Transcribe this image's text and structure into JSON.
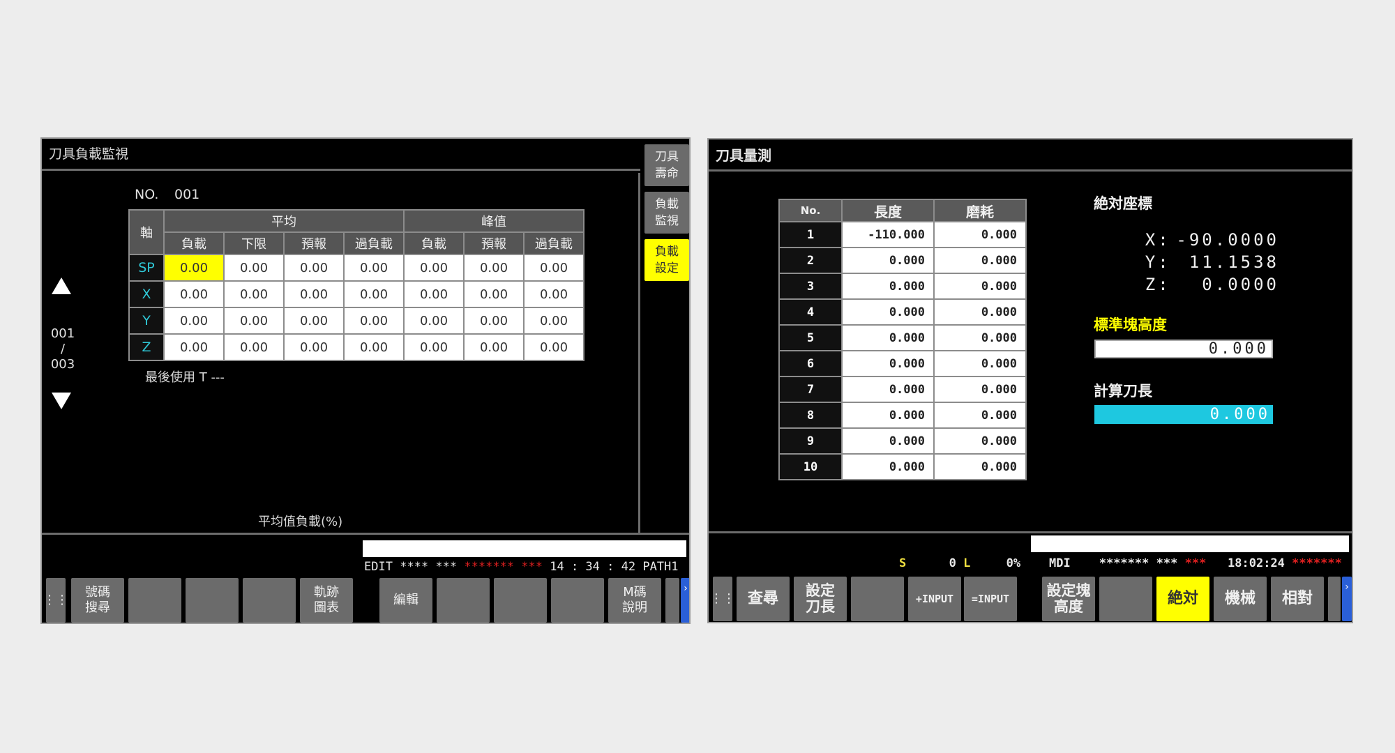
{
  "left": {
    "title": "刀具負載監視",
    "no_label": "NO.",
    "no_value": "001",
    "table": {
      "axis_header": "軸",
      "group_avg": "平均",
      "group_peak": "峰值",
      "sub_headers": [
        "負載",
        "下限",
        "預報",
        "過負載",
        "負載",
        "預報",
        "過負載"
      ],
      "rows": [
        {
          "axis": "SP",
          "values": [
            "0.00",
            "0.00",
            "0.00",
            "0.00",
            "0.00",
            "0.00",
            "0.00"
          ]
        },
        {
          "axis": "X",
          "values": [
            "0.00",
            "0.00",
            "0.00",
            "0.00",
            "0.00",
            "0.00",
            "0.00"
          ]
        },
        {
          "axis": "Y",
          "values": [
            "0.00",
            "0.00",
            "0.00",
            "0.00",
            "0.00",
            "0.00",
            "0.00"
          ]
        },
        {
          "axis": "Z",
          "values": [
            "0.00",
            "0.00",
            "0.00",
            "0.00",
            "0.00",
            "0.00",
            "0.00"
          ]
        }
      ]
    },
    "last_used": "最後使用 T  ---",
    "page_current": "001",
    "page_sep": "/",
    "page_total": "003",
    "avg_caption": "平均值負載(%)",
    "side_buttons": [
      {
        "line1": "刀具",
        "line2": "壽命"
      },
      {
        "line1": "負載",
        "line2": "監視"
      },
      {
        "line1": "負載",
        "line2": "設定"
      }
    ],
    "status": {
      "mode": "EDIT",
      "s1": "****",
      "s2": "***",
      "s3": "*******",
      "s4": "***",
      "time": "14 : 34 : 42",
      "path": "PATH1"
    },
    "softkeys": {
      "k1a": "號碼",
      "k1b": "搜尋",
      "k2a": "軌跡",
      "k2b": "圖表",
      "k3": "編輯",
      "k4a": "M碼",
      "k4b": "說明",
      "more": "›"
    }
  },
  "right": {
    "title": "刀具量測",
    "table": {
      "headers": [
        "No.",
        "長度",
        "磨耗"
      ],
      "rows": [
        {
          "no": "1",
          "length": "-110.000",
          "wear": "0.000"
        },
        {
          "no": "2",
          "length": "0.000",
          "wear": "0.000"
        },
        {
          "no": "3",
          "length": "0.000",
          "wear": "0.000"
        },
        {
          "no": "4",
          "length": "0.000",
          "wear": "0.000"
        },
        {
          "no": "5",
          "length": "0.000",
          "wear": "0.000"
        },
        {
          "no": "6",
          "length": "0.000",
          "wear": "0.000"
        },
        {
          "no": "7",
          "length": "0.000",
          "wear": "0.000"
        },
        {
          "no": "8",
          "length": "0.000",
          "wear": "0.000"
        },
        {
          "no": "9",
          "length": "0.000",
          "wear": "0.000"
        },
        {
          "no": "10",
          "length": "0.000",
          "wear": "0.000"
        }
      ]
    },
    "abs_title": "絶対座標",
    "coord": {
      "x_label": "X:",
      "x_value": "-90.0000",
      "y_label": "Y:",
      "y_value": "11.1538",
      "z_label": "Z:",
      "z_value": "0.0000"
    },
    "std_block_title": "標準塊高度",
    "std_block_value": "0.000",
    "calc_length_title": "計算刀長",
    "calc_length_value": "0.000",
    "status": {
      "s_label": "S",
      "s_value": "0",
      "l_label": "L",
      "l_value": "0%",
      "mode": "MDI",
      "s1": "*******",
      "s2": "***",
      "s3": "***",
      "time": "18:02:24",
      "s4": "*******"
    },
    "softkeys": {
      "search": "查尋",
      "set_len_a": "設定",
      "set_len_b": "刀長",
      "plus_input": "+INPUT",
      "eq_input": "=INPUT",
      "set_blk_a": "設定塊",
      "set_blk_b": "高度",
      "absolute": "絶対",
      "machine": "機械",
      "relative": "相對",
      "more": "›"
    }
  },
  "colors": {
    "highlight": "#ffff00",
    "cyan": "#1ec8e0",
    "axis_text": "#2fc7d6",
    "alarm_red": "#e02020"
  }
}
